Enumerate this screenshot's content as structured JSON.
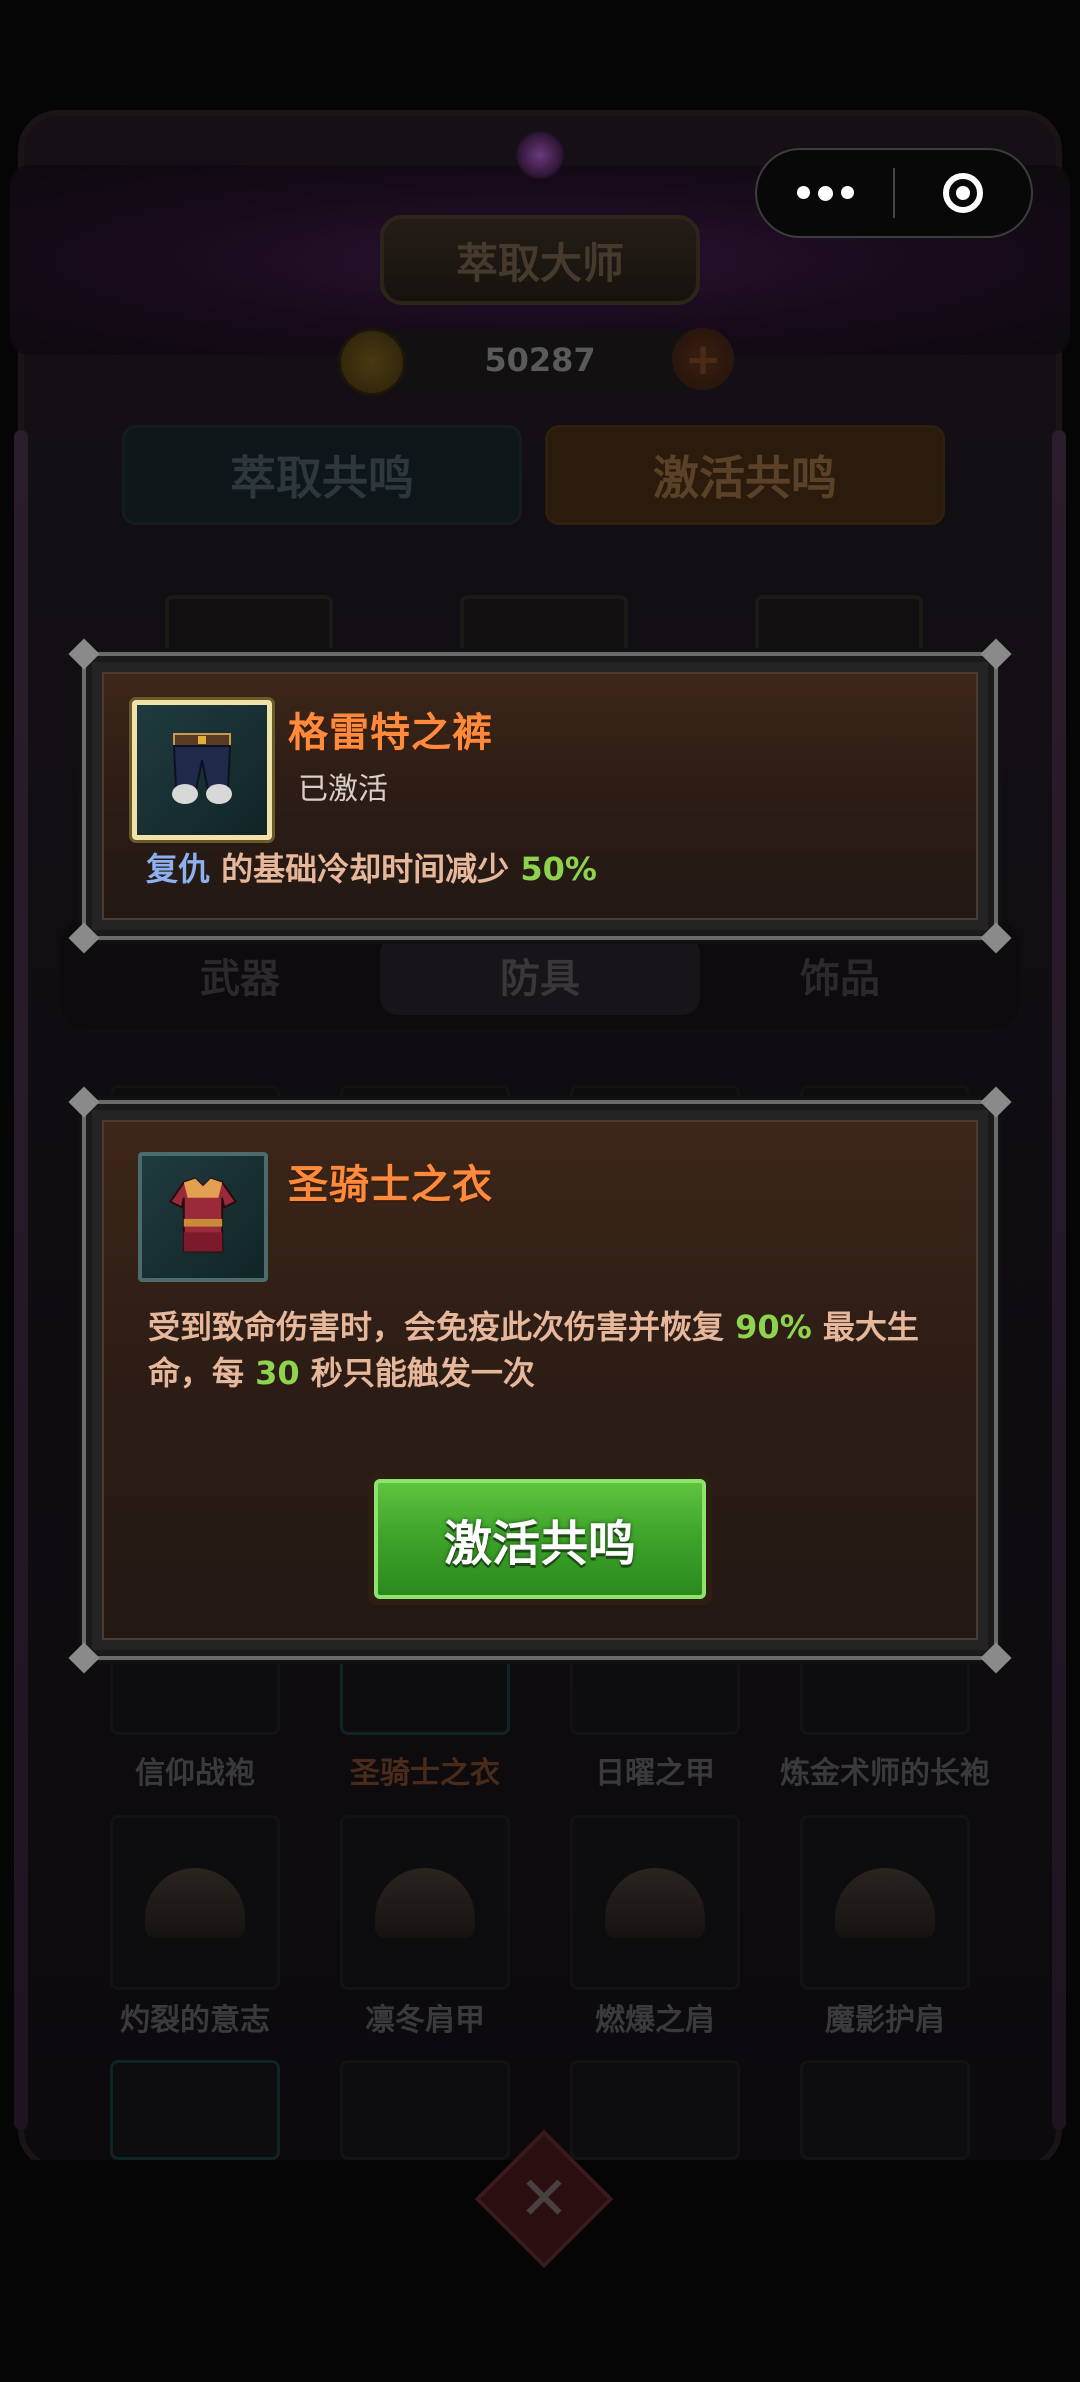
{
  "capsule": {
    "more_icon": "more-dots-icon",
    "close_icon": "target-icon"
  },
  "header": {
    "title": "萃取大师",
    "coins": "50287"
  },
  "top_tabs": [
    {
      "label": "萃取共鸣"
    },
    {
      "label": "激活共鸣"
    }
  ],
  "category_tabs": [
    {
      "label": "武器"
    },
    {
      "label": "防具"
    },
    {
      "label": "饰品"
    }
  ],
  "grid_row1_labels": [
    "信仰战袍",
    "圣骑士之衣",
    "日曜之甲",
    "炼金术师的长袍"
  ],
  "grid_row2_labels": [
    "灼裂的意志",
    "凛冬肩甲",
    "燃爆之肩",
    "魔影护肩"
  ],
  "popup_top": {
    "item_name": "格雷特之裤",
    "status": "已激活",
    "desc": {
      "skill": "复仇",
      "text": " 的基础冷却时间减少 ",
      "value": "50%"
    }
  },
  "popup_bottom": {
    "item_name": "圣骑士之衣",
    "desc": {
      "part1": "受到致命伤害时，会免疫此次伤害并恢复 ",
      "value1": "90%",
      "part2": " 最大生命，每 ",
      "value2": "30",
      "part3": " 秒只能触发一次"
    },
    "button_label": "激活共鸣"
  },
  "colors": {
    "accent_orange": "#ff8a3c",
    "value_green": "#8ed34e",
    "skill_blue": "#8eb0f0",
    "button_green": "#3fa52b"
  }
}
